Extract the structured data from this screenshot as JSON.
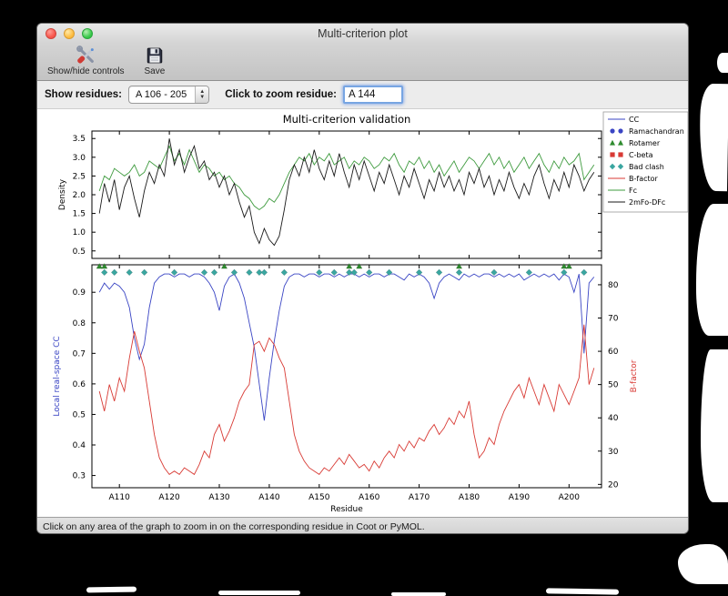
{
  "window": {
    "title": "Multi-criterion plot"
  },
  "toolbar": {
    "show_hide_label": "Show/hide controls",
    "save_label": "Save"
  },
  "controls": {
    "show_residues_label": "Show residues:",
    "residue_range_value": "A 106 - 205",
    "stepper_up": "▲",
    "stepper_down": "▼",
    "zoom_residue_label": "Click to zoom residue:",
    "zoom_residue_value": "A 144"
  },
  "status": {
    "text": "Click on any area of the graph to zoom in on the corresponding residue in Coot or PyMOL."
  },
  "chart_data": {
    "type": "line",
    "title": "Multi-criterion validation",
    "xlabel": "Residue",
    "residue_start": 106,
    "xlim": [
      104.5,
      206.5
    ],
    "x_ticks": [
      "A110",
      "A120",
      "A130",
      "A140",
      "A150",
      "A160",
      "A170",
      "A180",
      "A190",
      "A200"
    ],
    "x_tick_values": [
      110,
      120,
      130,
      140,
      150,
      160,
      170,
      180,
      190,
      200
    ],
    "top_plot": {
      "ylabel": "Density",
      "ylim": [
        0.3,
        3.7
      ],
      "yticks": [
        0.5,
        1.0,
        1.5,
        2.0,
        2.5,
        3.0,
        3.5
      ],
      "series": [
        {
          "name": "Fc",
          "color": "#3f9b3f",
          "values": [
            2.1,
            2.5,
            2.4,
            2.7,
            2.6,
            2.5,
            2.6,
            2.8,
            2.5,
            2.6,
            2.9,
            2.8,
            2.7,
            3.0,
            3.3,
            2.9,
            3.1,
            2.8,
            3.2,
            2.9,
            2.6,
            2.8,
            2.7,
            2.5,
            2.6,
            2.4,
            2.5,
            2.3,
            2.2,
            2.0,
            1.9,
            1.7,
            1.6,
            1.7,
            1.9,
            1.8,
            2.0,
            2.3,
            2.6,
            2.8,
            3.0,
            2.9,
            3.1,
            2.8,
            3.0,
            2.9,
            3.1,
            2.8,
            2.9,
            3.0,
            2.7,
            2.9,
            2.8,
            3.0,
            2.9,
            2.7,
            2.8,
            3.0,
            2.9,
            3.1,
            2.8,
            2.6,
            2.9,
            2.8,
            3.0,
            2.7,
            2.9,
            2.6,
            2.8,
            2.5,
            2.7,
            2.9,
            2.6,
            2.8,
            3.0,
            2.9,
            2.7,
            2.9,
            3.1,
            2.8,
            3.0,
            2.7,
            2.9,
            2.6,
            2.8,
            3.0,
            2.7,
            2.9,
            3.1,
            2.8,
            2.6,
            2.9,
            2.7,
            3.0,
            2.8,
            2.9,
            3.1,
            2.4,
            2.6,
            2.8
          ]
        },
        {
          "name": "2mFo-DFc",
          "color": "#1a1a1a",
          "values": [
            1.5,
            2.3,
            1.8,
            2.4,
            1.6,
            2.2,
            2.5,
            1.9,
            1.4,
            2.1,
            2.6,
            2.3,
            2.8,
            2.5,
            3.5,
            2.8,
            3.2,
            2.6,
            3.0,
            3.3,
            2.7,
            2.9,
            2.4,
            2.6,
            2.2,
            2.5,
            2.0,
            2.3,
            1.8,
            1.4,
            1.7,
            1.0,
            0.7,
            1.1,
            0.8,
            0.65,
            0.9,
            1.6,
            2.4,
            2.8,
            2.5,
            3.0,
            2.6,
            3.2,
            2.7,
            2.4,
            2.9,
            2.5,
            3.1,
            2.6,
            2.2,
            2.8,
            2.4,
            2.9,
            2.5,
            2.1,
            2.6,
            2.3,
            2.8,
            2.4,
            2.0,
            2.5,
            2.2,
            2.7,
            2.3,
            1.9,
            2.4,
            2.1,
            2.6,
            2.2,
            2.5,
            2.1,
            2.4,
            2.0,
            2.6,
            2.3,
            2.7,
            2.2,
            2.5,
            2.0,
            2.4,
            2.1,
            2.6,
            2.2,
            1.9,
            2.3,
            2.0,
            2.5,
            2.8,
            2.3,
            1.9,
            2.4,
            2.1,
            2.6,
            2.2,
            2.8,
            2.5,
            2.1,
            2.4,
            2.6
          ]
        }
      ]
    },
    "bottom_plot": {
      "ylabel_left": "Local real-space CC",
      "ylabel_right": "B-factor",
      "ylim_left": [
        0.26,
        0.99
      ],
      "ylim_right": [
        19,
        86
      ],
      "yticks_left": [
        0.3,
        0.4,
        0.5,
        0.6,
        0.7,
        0.8,
        0.9
      ],
      "yticks_right": [
        20,
        30,
        40,
        50,
        60,
        70,
        80
      ],
      "series": [
        {
          "name": "CC",
          "axis": "left",
          "color": "#3a45c4",
          "values": [
            0.9,
            0.93,
            0.91,
            0.93,
            0.92,
            0.9,
            0.85,
            0.75,
            0.68,
            0.73,
            0.85,
            0.93,
            0.95,
            0.96,
            0.96,
            0.95,
            0.96,
            0.96,
            0.95,
            0.96,
            0.96,
            0.95,
            0.93,
            0.9,
            0.84,
            0.92,
            0.95,
            0.96,
            0.93,
            0.88,
            0.8,
            0.72,
            0.6,
            0.48,
            0.62,
            0.74,
            0.84,
            0.92,
            0.95,
            0.96,
            0.96,
            0.95,
            0.96,
            0.96,
            0.95,
            0.96,
            0.96,
            0.95,
            0.96,
            0.95,
            0.96,
            0.96,
            0.95,
            0.96,
            0.95,
            0.96,
            0.96,
            0.95,
            0.96,
            0.96,
            0.95,
            0.94,
            0.96,
            0.95,
            0.96,
            0.95,
            0.93,
            0.88,
            0.93,
            0.95,
            0.96,
            0.95,
            0.94,
            0.96,
            0.95,
            0.96,
            0.95,
            0.96,
            0.96,
            0.95,
            0.96,
            0.95,
            0.96,
            0.95,
            0.96,
            0.94,
            0.95,
            0.96,
            0.95,
            0.96,
            0.95,
            0.96,
            0.94,
            0.96,
            0.95,
            0.9,
            0.96,
            0.7,
            0.93,
            0.95
          ]
        },
        {
          "name": "B-factor",
          "axis": "right",
          "color": "#d83a34",
          "values": [
            48,
            42,
            50,
            45,
            52,
            48,
            58,
            66,
            60,
            55,
            45,
            35,
            28,
            25,
            23,
            24,
            23,
            25,
            24,
            23,
            26,
            30,
            28,
            35,
            38,
            33,
            36,
            40,
            45,
            48,
            50,
            62,
            63,
            60,
            64,
            62,
            58,
            55,
            45,
            35,
            30,
            27,
            25,
            24,
            23,
            25,
            24,
            26,
            28,
            26,
            29,
            27,
            25,
            26,
            24,
            27,
            25,
            28,
            30,
            28,
            32,
            30,
            33,
            31,
            34,
            33,
            36,
            38,
            35,
            37,
            40,
            38,
            42,
            40,
            45,
            35,
            28,
            30,
            34,
            32,
            38,
            42,
            45,
            48,
            50,
            46,
            52,
            48,
            44,
            50,
            46,
            42,
            50,
            47,
            44,
            48,
            52,
            68,
            50,
            55
          ]
        }
      ],
      "markers": [
        {
          "name": "Rotamer",
          "shape": "triangle",
          "color": "#2e8b2e",
          "y": 0.985,
          "residues": [
            106,
            107,
            131,
            156,
            158,
            178,
            199,
            200
          ]
        },
        {
          "name": "Bad clash",
          "shape": "diamond",
          "color": "#3aa6a0",
          "y": 0.965,
          "residues": [
            107,
            109,
            112,
            115,
            121,
            127,
            129,
            133,
            136,
            138,
            139,
            143,
            150,
            153,
            156,
            157,
            160,
            164,
            170,
            174,
            178,
            185,
            192,
            199,
            203
          ]
        }
      ]
    },
    "legend": [
      {
        "label": "CC",
        "glyph": "line",
        "color": "#3a45c4"
      },
      {
        "label": "Ramachandran",
        "glyph": "circle",
        "color": "#3a45c4"
      },
      {
        "label": "Rotamer",
        "glyph": "triangle",
        "color": "#2e8b2e"
      },
      {
        "label": "C-beta",
        "glyph": "square",
        "color": "#d83a34"
      },
      {
        "label": "Bad clash",
        "glyph": "diamond",
        "color": "#3aa6a0"
      },
      {
        "label": "B-factor",
        "glyph": "line",
        "color": "#d83a34"
      },
      {
        "label": "Fc",
        "glyph": "line",
        "color": "#3f9b3f"
      },
      {
        "label": "2mFo-DFc",
        "glyph": "line",
        "color": "#1a1a1a"
      }
    ]
  }
}
